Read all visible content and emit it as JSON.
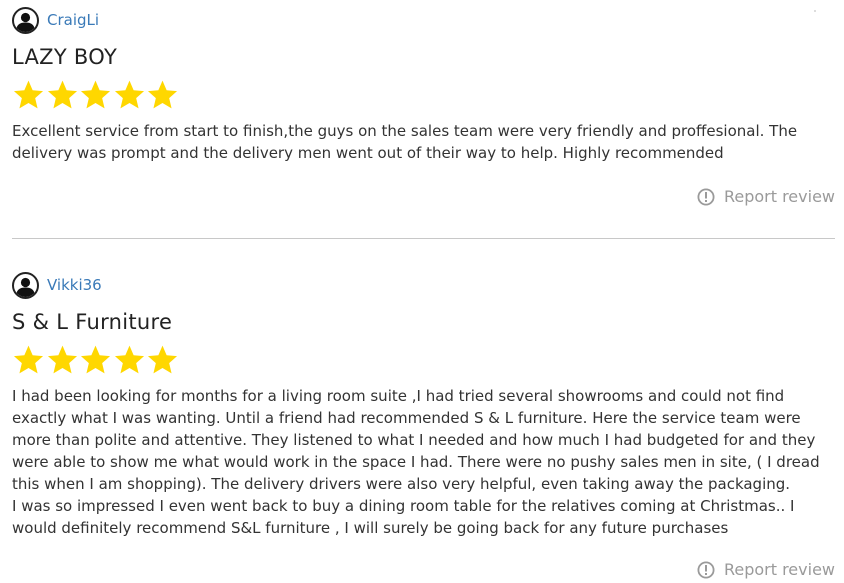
{
  "reviews": [
    {
      "username": "CraigLi",
      "title": "LAZY BOY",
      "rating": 5,
      "rating_max": 5,
      "body": [
        "Excellent service from start to finish,the guys on the sales team were very friendly and proffesional. The delivery was prompt and the delivery men went out of their way to help. Highly recommended"
      ],
      "report_label": "Report review"
    },
    {
      "username": "Vikki36",
      "title": "S & L Furniture",
      "rating": 5,
      "rating_max": 5,
      "body": [
        "I had been looking for months for a living room suite ,I had tried several showrooms and could not find exactly what I was wanting. Until a friend had recommended S & L furniture. Here the service team were more than polite and attentive. They listened to what I needed and how much I had budgeted for and they were able to show me what would work in the space I had. There were no pushy sales men in site, ( I dread this when I am shopping). The delivery drivers were also very helpful, even taking away the packaging.",
        "I was so impressed I even went back to buy a dining room table for the relatives coming at Christmas.. I would definitely recommend S&L furniture , I will surely be going back for any future purchases"
      ],
      "report_label": "Report review"
    }
  ],
  "colors": {
    "username": "#3a7ab8",
    "star": "#ffd700",
    "report": "#9a9a9a",
    "divider": "#c8c8c8"
  },
  "icons": {
    "avatar": "user-avatar-icon",
    "star": "star-icon",
    "report": "exclamation-circle-icon"
  }
}
